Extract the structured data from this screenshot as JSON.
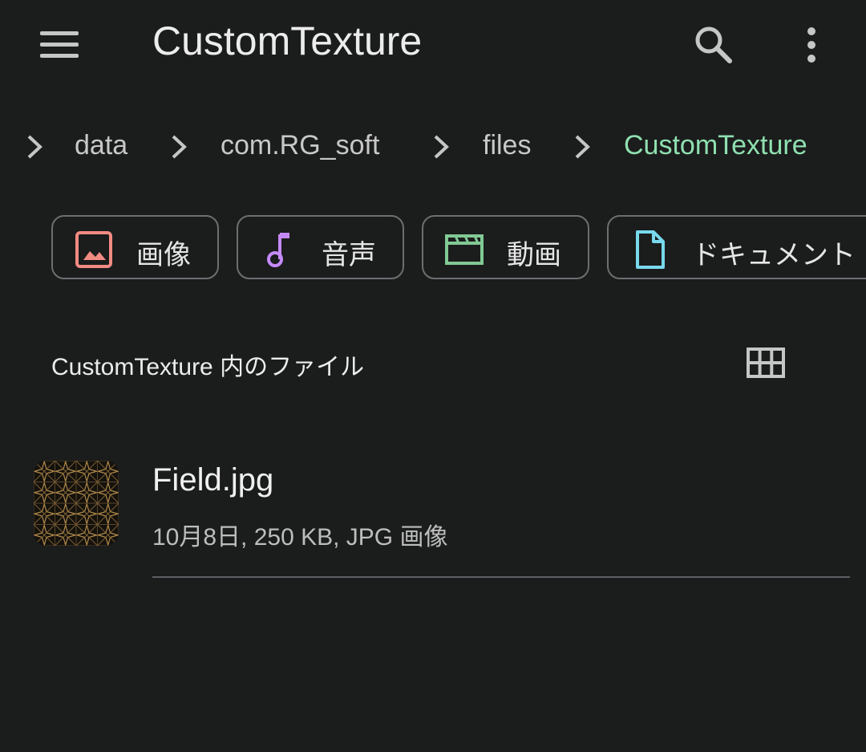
{
  "app_bar": {
    "title": "CustomTexture",
    "menu_icon": "hamburger-menu-icon",
    "search_icon": "search-icon",
    "more_icon": "more-vert-icon"
  },
  "breadcrumb": {
    "items": [
      "data",
      "com.RG_soft",
      "files",
      "CustomTexture"
    ],
    "active_color": "#8fe0b0"
  },
  "chips": [
    {
      "label": "画像",
      "icon": "image-icon",
      "color": "#f28b82"
    },
    {
      "label": "音声",
      "icon": "music-note-icon",
      "color": "#c58af9"
    },
    {
      "label": "動画",
      "icon": "movie-icon",
      "color": "#81c995"
    },
    {
      "label": "ドキュメント",
      "icon": "document-icon",
      "color": "#78d9ec"
    }
  ],
  "section": {
    "title": "CustomTexture 内のファイル",
    "view_toggle_icon": "grid-view-icon"
  },
  "files": [
    {
      "name": "Field.jpg",
      "meta": "10月8日, 250 KB, JPG 画像"
    }
  ]
}
